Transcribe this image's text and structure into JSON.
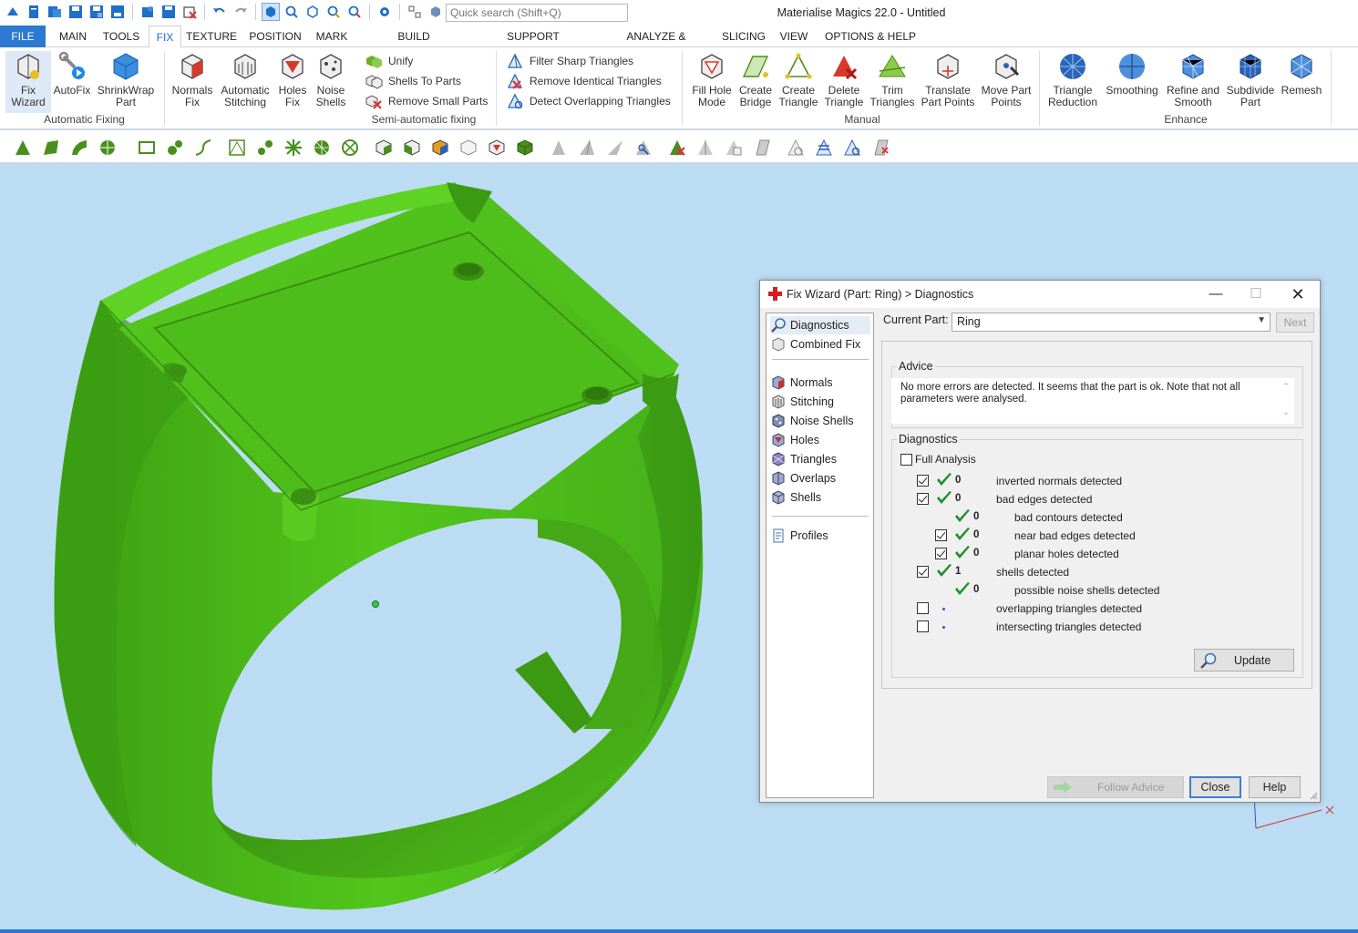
{
  "app": {
    "title": "Materialise Magics 22.0 - Untitled",
    "search_placeholder": "Quick search (Shift+Q)"
  },
  "tabs": [
    "FILE",
    "MAIN",
    "TOOLS",
    "FIX",
    "TEXTURE",
    "POSITION",
    "MARK",
    "BUILD PREPARATION",
    "SUPPORT GENERATION",
    "ANALYZE & REPORT",
    "SLICING",
    "VIEW",
    "OPTIONS & HELP"
  ],
  "active_tab": "FIX",
  "ribbon": {
    "automatic_fixing": {
      "label": "Automatic Fixing",
      "fix_wizard": [
        "Fix",
        "Wizard"
      ],
      "autofix": "AutoFix",
      "shrinkwrap": [
        "ShrinkWrap",
        "Part"
      ]
    },
    "semi_automatic": {
      "label": "Semi-automatic fixing",
      "normals_fix": [
        "Normals",
        "Fix"
      ],
      "automatic_stitching": [
        "Automatic",
        "Stitching"
      ],
      "holes_fix": [
        "Holes",
        "Fix"
      ],
      "noise_shells": [
        "Noise",
        "Shells"
      ],
      "unify": "Unify",
      "shells_to_parts": "Shells To Parts",
      "remove_small_parts": "Remove Small Parts",
      "filter_sharp": "Filter Sharp Triangles",
      "remove_identical": "Remove Identical Triangles",
      "detect_overlapping": "Detect Overlapping Triangles"
    },
    "manual": {
      "label": "Manual",
      "fill_hole_mode": [
        "Fill Hole",
        "Mode"
      ],
      "create_bridge": [
        "Create",
        "Bridge"
      ],
      "create_triangle": [
        "Create",
        "Triangle"
      ],
      "delete_triangle": [
        "Delete",
        "Triangle"
      ],
      "trim_triangles": [
        "Trim",
        "Triangles"
      ],
      "translate_part_points": [
        "Translate",
        "Part Points"
      ],
      "move_part_points": [
        "Move Part",
        "Points"
      ]
    },
    "enhance": {
      "label": "Enhance",
      "triangle_reduction": [
        "Triangle",
        "Reduction"
      ],
      "smoothing": "Smoothing",
      "refine_and_smooth": [
        "Refine and",
        "Smooth"
      ],
      "subdivide_part": [
        "Subdivide",
        "Part"
      ],
      "remesh": "Remesh"
    }
  },
  "dialog": {
    "title": "Fix Wizard (Part: Ring) > Diagnostics",
    "nav": {
      "diagnostics": "Diagnostics",
      "combined_fix": "Combined Fix",
      "normals": "Normals",
      "stitching": "Stitching",
      "noise_shells": "Noise Shells",
      "holes": "Holes",
      "triangles": "Triangles",
      "overlaps": "Overlaps",
      "shells": "Shells",
      "profiles": "Profiles"
    },
    "current_part_label": "Current Part:",
    "current_part_value": "Ring",
    "next_label": "Next",
    "advice_legend": "Advice",
    "advice_text": "No more errors are detected. It seems that the part is ok. Note that not all parameters were analysed.",
    "diagnostics_legend": "Diagnostics",
    "full_analysis_label": "Full Analysis",
    "rows": [
      {
        "checkbox": true,
        "checked": true,
        "status": "ok",
        "count": "0",
        "text": "inverted normals detected",
        "indent": 0
      },
      {
        "checkbox": true,
        "checked": true,
        "status": "ok",
        "count": "0",
        "text": "bad edges detected",
        "indent": 0
      },
      {
        "checkbox": false,
        "checked": false,
        "status": "ok",
        "count": "0",
        "text": "bad contours detected",
        "indent": 1
      },
      {
        "checkbox": true,
        "checked": true,
        "status": "ok",
        "count": "0",
        "text": "near bad edges detected",
        "indent": 1
      },
      {
        "checkbox": true,
        "checked": true,
        "status": "ok",
        "count": "0",
        "text": "planar holes detected",
        "indent": 1
      },
      {
        "checkbox": true,
        "checked": true,
        "status": "ok",
        "count": "1",
        "text": "shells detected",
        "indent": 0
      },
      {
        "checkbox": false,
        "checked": false,
        "status": "ok",
        "count": "0",
        "text": "possible noise shells detected",
        "indent": 1
      },
      {
        "checkbox": true,
        "checked": false,
        "status": "unknown",
        "count": "",
        "text": "overlapping triangles detected",
        "indent": 0
      },
      {
        "checkbox": true,
        "checked": false,
        "status": "unknown",
        "count": "",
        "text": "intersecting triangles detected",
        "indent": 0
      }
    ],
    "update_label": "Update",
    "follow_advice_label": "Follow Advice",
    "close_label": "Close",
    "help_label": "Help"
  },
  "colors": {
    "accent": "#2b79d0",
    "viewport_bg": "#bcdcf3",
    "model_green": "#4cc01b",
    "check_green": "#1f8f2a"
  }
}
